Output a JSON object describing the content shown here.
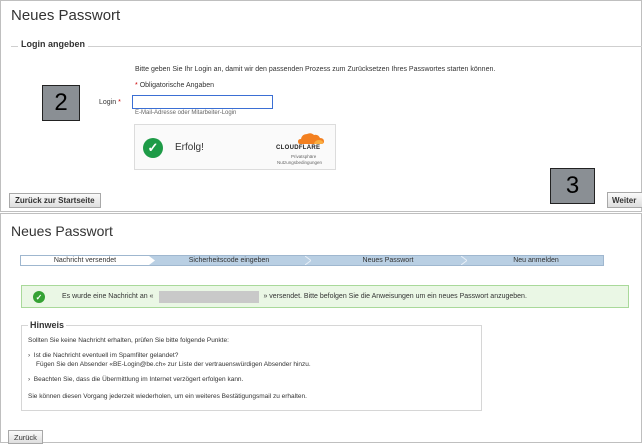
{
  "panel1": {
    "title": "Neues Passwort",
    "section_legend": "Login angeben",
    "instruction": "Bitte geben Sie Ihr Login an, damit wir den passenden Prozess zum Zurücksetzen Ihres Passwortes starten können.",
    "required_star": "*",
    "required_text": "Obligatorische Angaben",
    "badge": "2",
    "login_label": "Login",
    "login_star": "*",
    "login_value": "",
    "login_hint": "E-Mail-Adresse oder Mitarbeiter-Login",
    "captcha": {
      "status": "Erfolg!",
      "logo_text": "CLOUDFLARE",
      "privacy": "Privatsphäre",
      "terms": "Nutzungsbedingungen"
    },
    "back_button": "Zurück zur Startseite",
    "badge_next": "3",
    "next_button": "Weiter"
  },
  "panel2": {
    "title": "Neues Passwort",
    "steps": [
      "Nachricht versendet",
      "Sicherheitscode eingeben",
      "Neues Passwort",
      "Neu anmelden"
    ],
    "success_prefix": "Es wurde eine Nachricht an «",
    "success_suffix": "» versendet. Bitte befolgen Sie die Anweisungen um ein neues Passwort anzugeben.",
    "hint": {
      "title": "Hinweis",
      "intro": "Sollten Sie keine Nachricht erhalten, prüfen Sie bitte folgende Punkte:",
      "item1_q": "Ist die Nachricht eventuell im Spamfilter gelandet?",
      "item1_a": "Fügen Sie den Absender «BE-Login@be.ch» zur Liste der vertrauenswürdigen Absender hinzu.",
      "item2": "Beachten Sie, dass die Übermittlung im Internet verzögert erfolgen kann.",
      "outro": "Sie können diesen Vorgang jederzeit wiederholen, um ein weiteres Bestätigungsmail zu erhalten."
    },
    "back_button": "Zurück"
  },
  "colors": {
    "success_green": "#1e9b47",
    "progress_blue": "#b9cfe3",
    "required_red": "#cc0000",
    "cloudflare_orange": "#f38020"
  }
}
